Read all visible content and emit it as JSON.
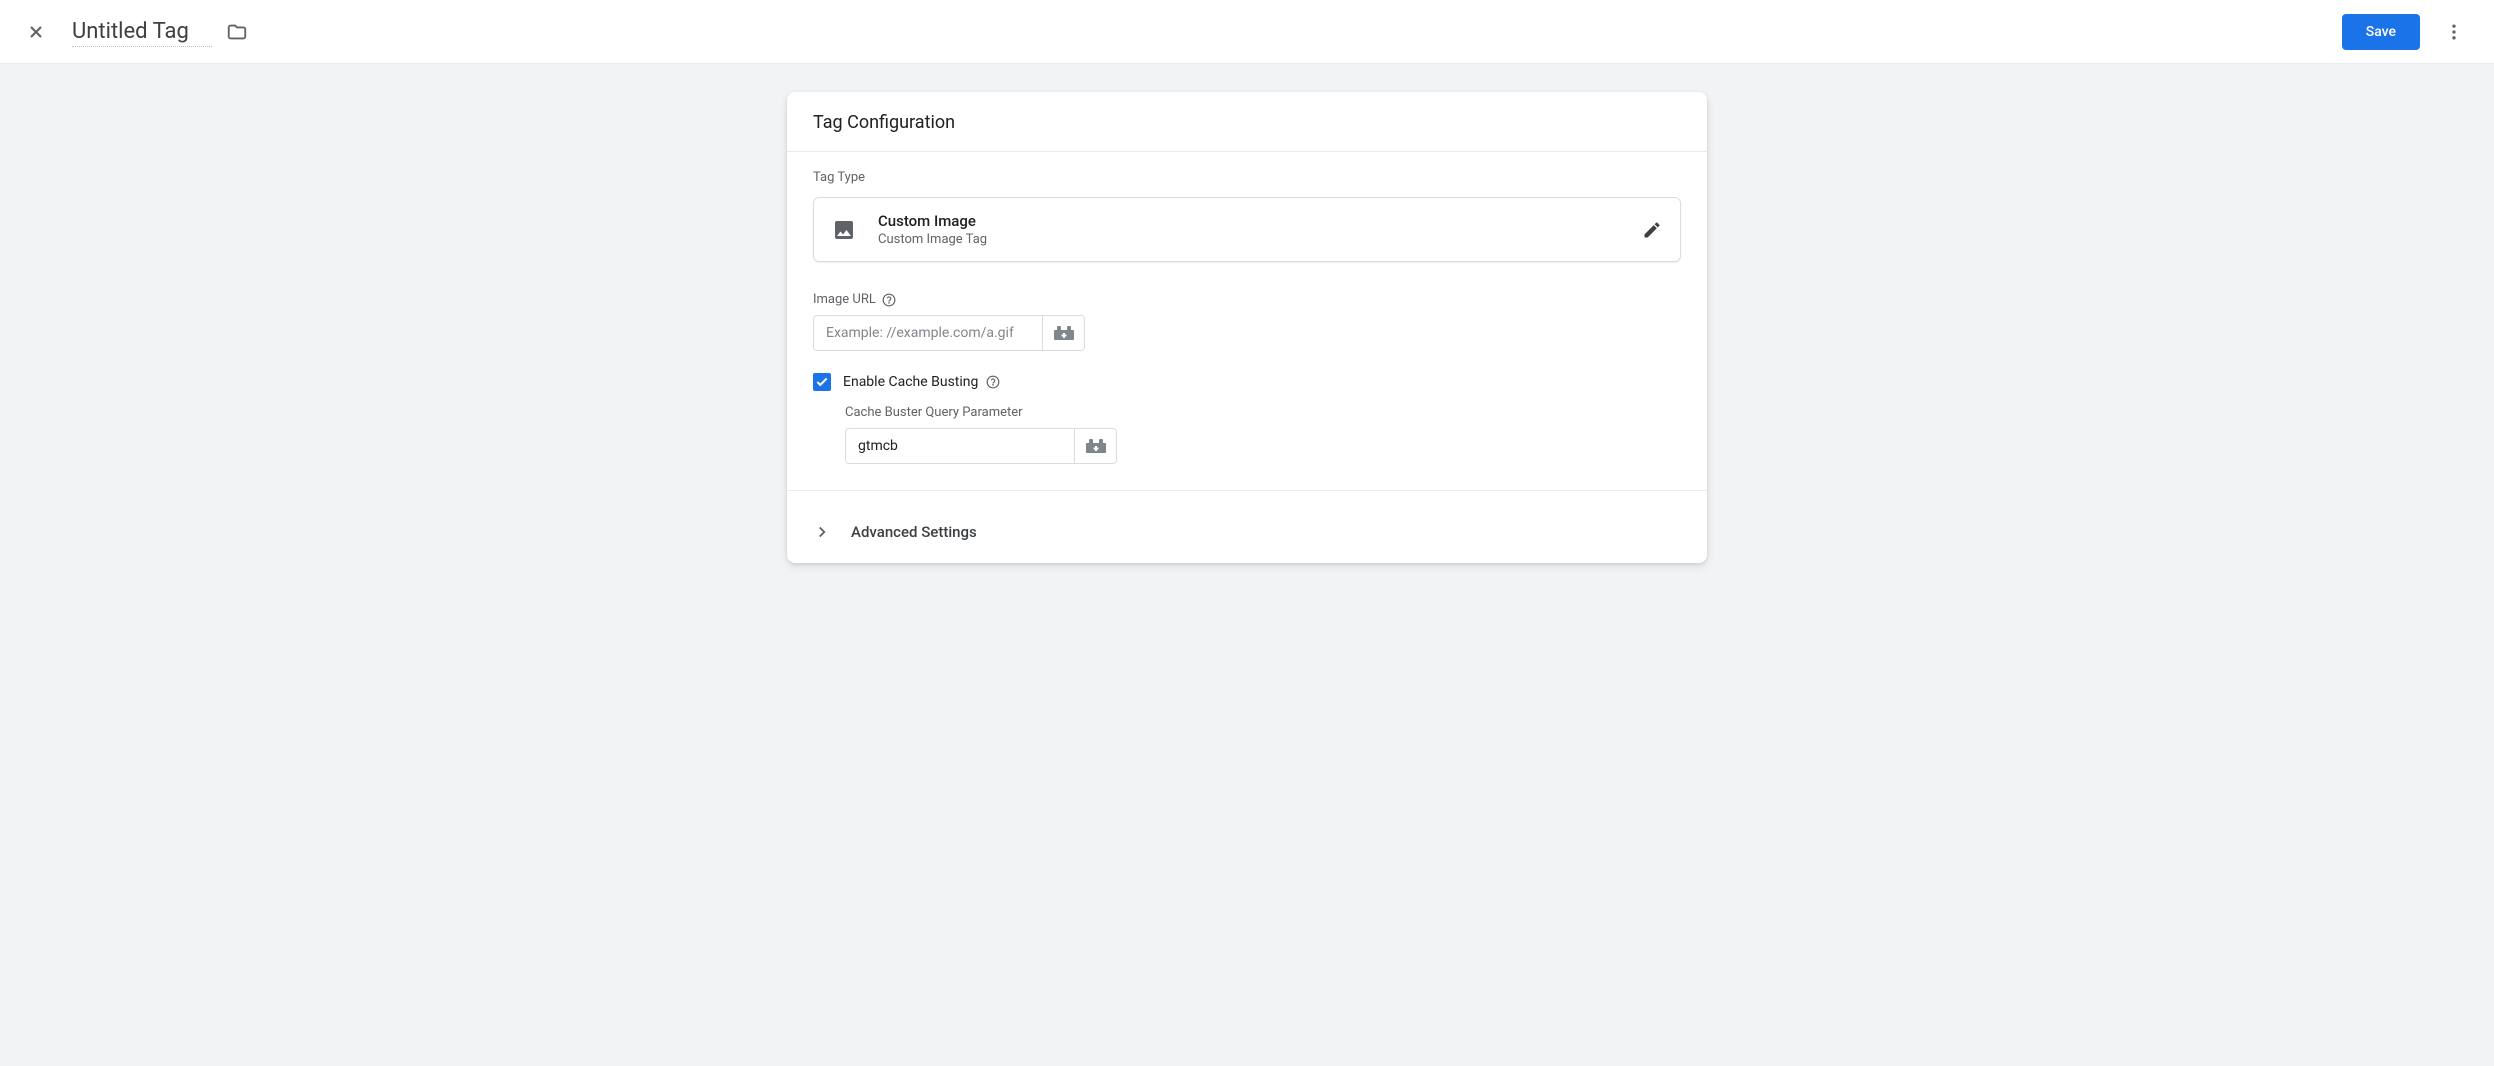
{
  "header": {
    "title_value": "Untitled Tag",
    "save_label": "Save"
  },
  "card": {
    "title": "Tag Configuration",
    "tag_type_label": "Tag Type",
    "tag_type": {
      "name": "Custom Image",
      "description": "Custom Image Tag"
    },
    "image_url": {
      "label": "Image URL",
      "placeholder": "Example: //example.com/a.gif",
      "value": ""
    },
    "cache_busting": {
      "checkbox_label": "Enable Cache Busting",
      "checked": true,
      "param_label": "Cache Buster Query Parameter",
      "param_value": "gtmcb"
    },
    "advanced_label": "Advanced Settings"
  }
}
